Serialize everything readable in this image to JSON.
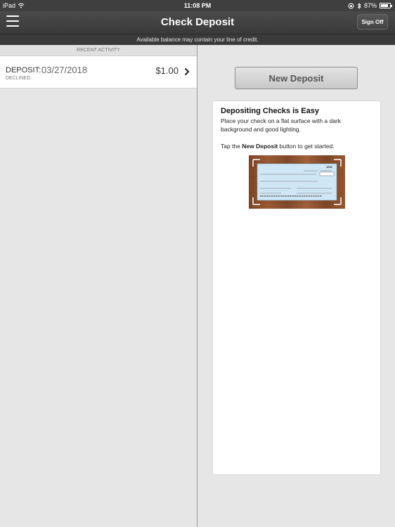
{
  "status_bar": {
    "device": "iPad",
    "time": "11:08 PM",
    "battery": "87%",
    "battery_level": 0.87,
    "icons": [
      "wifi-icon",
      "rotation-lock-icon",
      "bluetooth-icon",
      "battery-icon"
    ]
  },
  "nav": {
    "title": "Check Deposit",
    "sign_off": "Sign Off",
    "menu_icon": "hamburger-menu-icon"
  },
  "notice": "Available balance may contain your line of credit.",
  "recent": {
    "header": "RECENT ACTIVITY",
    "items": [
      {
        "type": "DEPOSIT:",
        "date": "03/27/2018",
        "status": "DECLINED",
        "amount": "$1.00",
        "icon": "chevron-right-icon"
      }
    ]
  },
  "main": {
    "new_deposit_label": "New Deposit",
    "info_card": {
      "title": "Depositing Checks is Easy",
      "body": "Place your check on a flat surface with a dark background and good lighting.",
      "tap_prefix": "Tap the ",
      "tap_bold": "New Deposit",
      "tap_suffix": " button to get started.",
      "check_number": "1001"
    }
  },
  "colors": {
    "header_bg": "#3f3f3f",
    "pane_bg": "#e6e6e6",
    "check_bg": "#cfe6f4",
    "wood": "#8a4f2b"
  }
}
